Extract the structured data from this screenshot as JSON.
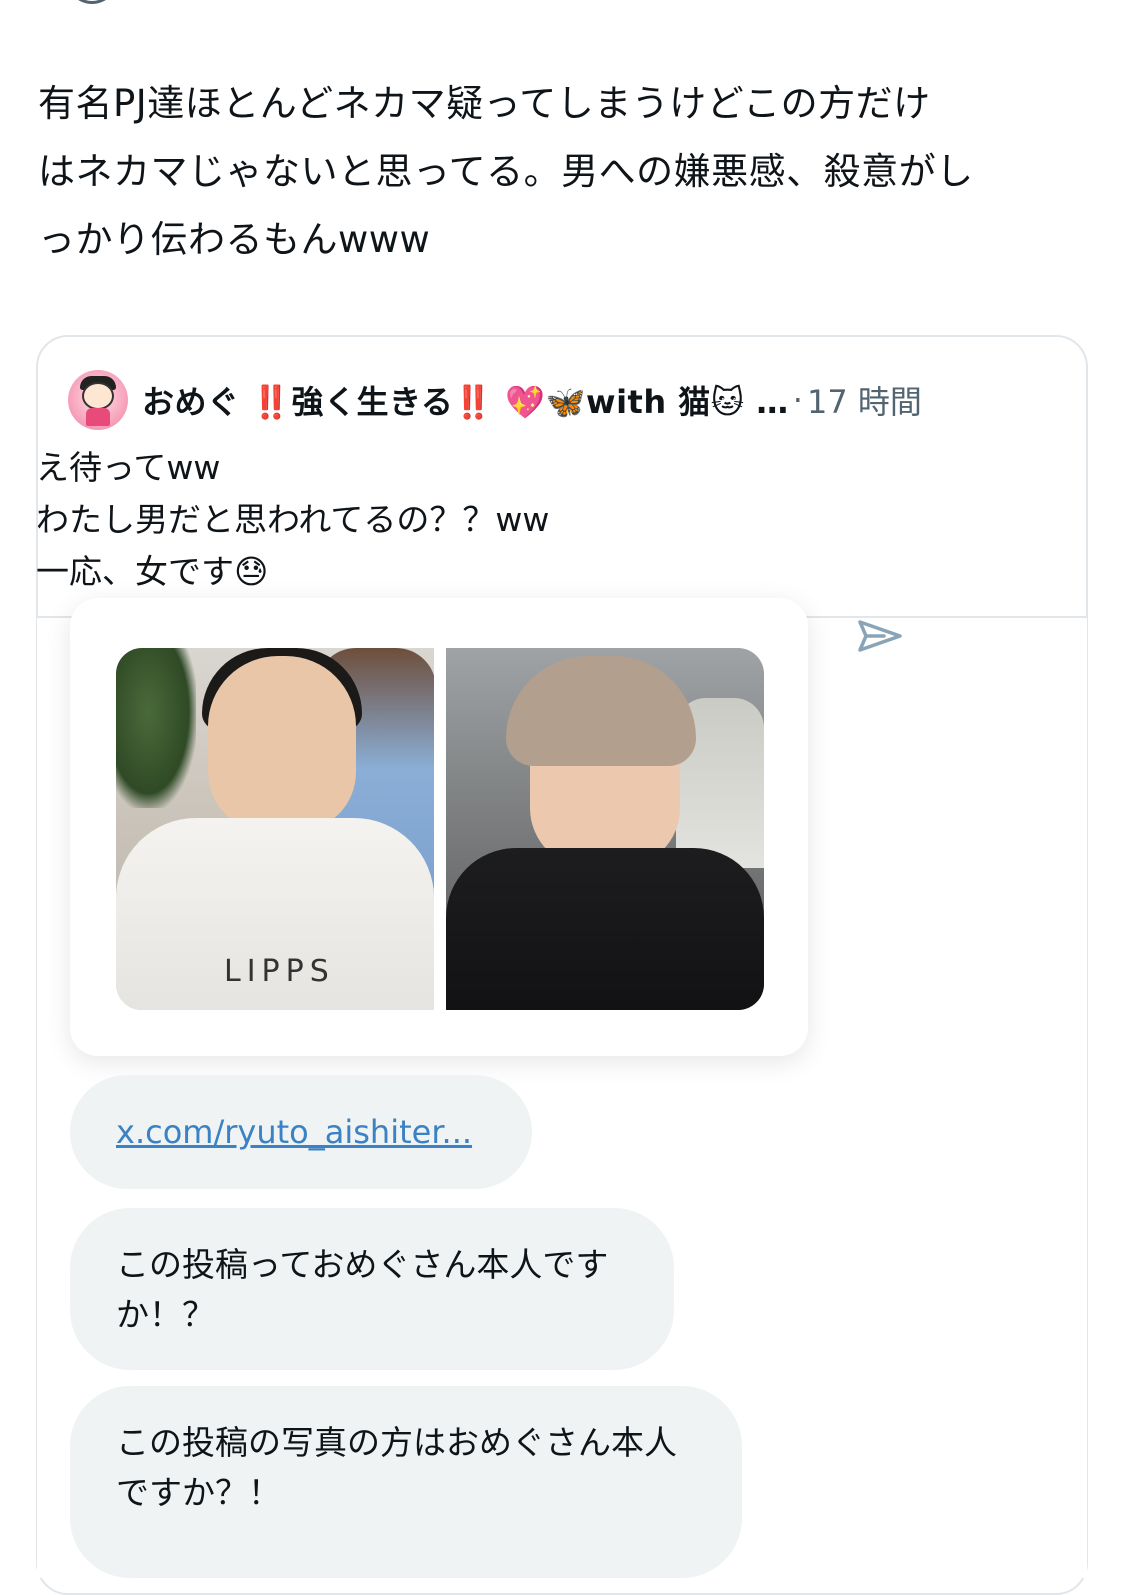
{
  "post": {
    "lines": [
      "有名PJ達ほとんどネカマ疑ってしまうけどこの方だけ",
      "はネカマじゃないと思ってる。男への嫌悪感、殺意がし",
      "っかり伝わるもんwww"
    ]
  },
  "quote": {
    "display_name": "おめぐ ‼️強く生きる‼️ 💖🦋with 猫🐱 …",
    "separator": "·",
    "time": "17 時間",
    "lines": [
      "え待ってww",
      "わたし男だと思われてるの？？ww",
      "一応、女です😓"
    ]
  },
  "media": {
    "cape_text": "LIPPS"
  },
  "messages": {
    "link": "x.com/ryuto_aishiter...",
    "msg1_lines": [
      "この投稿っておめぐさん本人です",
      "か！？"
    ],
    "msg2_lines": [
      "この投稿の写真の方はおめぐさん本人",
      "ですか？！"
    ]
  },
  "colors": {
    "text": "#0f1419",
    "muted": "#536471",
    "link": "#3b82c4",
    "bubble": "#eff3f4",
    "border": "#e1e6ea"
  },
  "icons": [
    "profile-partial-icon",
    "avatar",
    "send-icon"
  ]
}
